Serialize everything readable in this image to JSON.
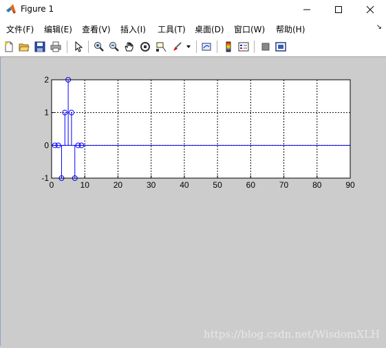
{
  "window": {
    "title": "Figure 1",
    "minimize_icon": "minimize-icon",
    "maximize_icon": "maximize-icon",
    "close_icon": "close-icon"
  },
  "menu": {
    "items": [
      "文件(F)",
      "编辑(E)",
      "查看(V)",
      "插入(I)",
      "工具(T)",
      "桌面(D)",
      "窗口(W)",
      "帮助(H)"
    ],
    "overflow_icon": "chevron-icon"
  },
  "toolbar": {
    "tools": [
      "new-figure-icon",
      "open-file-icon",
      "save-icon",
      "print-icon",
      "edit-plot-arrow-icon",
      "zoom-in-icon",
      "zoom-out-icon",
      "pan-hand-icon",
      "rotate-3d-icon",
      "data-cursor-icon",
      "brush-icon",
      "link-plot-icon",
      "colorbar-icon",
      "legend-icon",
      "hide-plot-tools-icon",
      "show-plot-tools-icon"
    ]
  },
  "watermark": "https://blog.csdn.net/WisdomXLH",
  "chart_data": {
    "type": "stem",
    "x": [
      1,
      2,
      3,
      4,
      5,
      6,
      7,
      8,
      9
    ],
    "y": [
      0,
      0,
      -1,
      1,
      2,
      1,
      -1,
      0,
      0
    ],
    "xlim": [
      0,
      90
    ],
    "ylim": [
      -1,
      2
    ],
    "xticks": [
      "0",
      "10",
      "20",
      "30",
      "40",
      "50",
      "60",
      "70",
      "80",
      "90"
    ],
    "yticks": [
      "-1",
      "0",
      "1",
      "2"
    ],
    "grid": true,
    "baseline_y": 0,
    "marker": "circle",
    "color": "#0000ff"
  }
}
